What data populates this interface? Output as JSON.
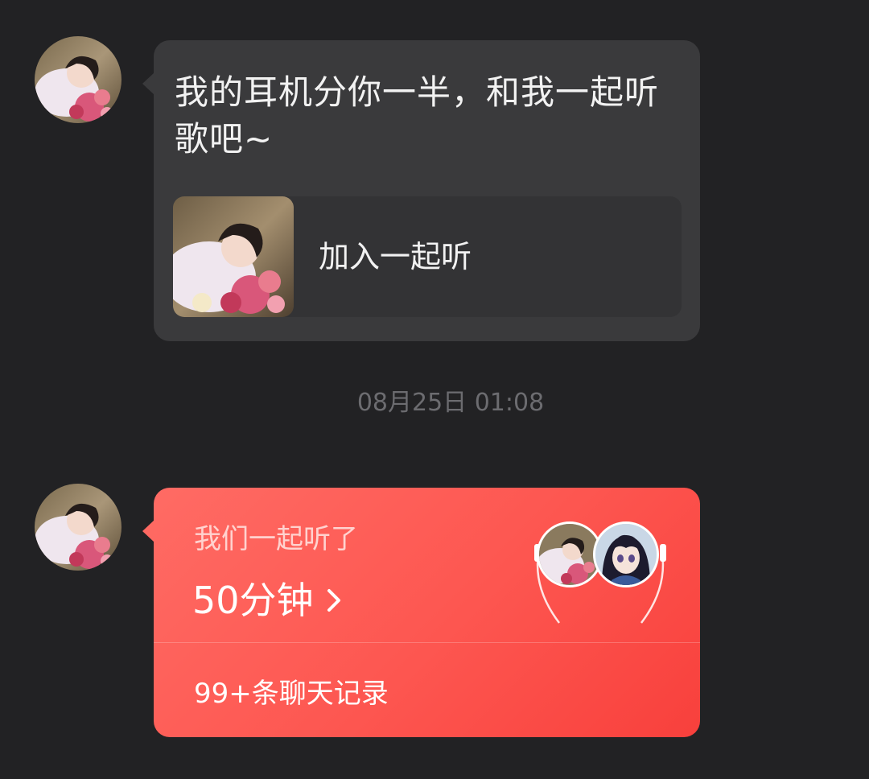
{
  "messages": [
    {
      "text": "我的耳机分你一半，和我一起听歌吧~",
      "card": {
        "label": "加入一起听"
      }
    }
  ],
  "timestamp": "08月25日 01:08",
  "listen_card": {
    "label": "我们一起听了",
    "duration": "50分钟",
    "records": "99+条聊天记录"
  },
  "colors": {
    "background": "#222224",
    "bubble": "#3a3a3c",
    "accent": "#fd5650"
  },
  "icons": {
    "chevron": "chevron-right-icon"
  }
}
